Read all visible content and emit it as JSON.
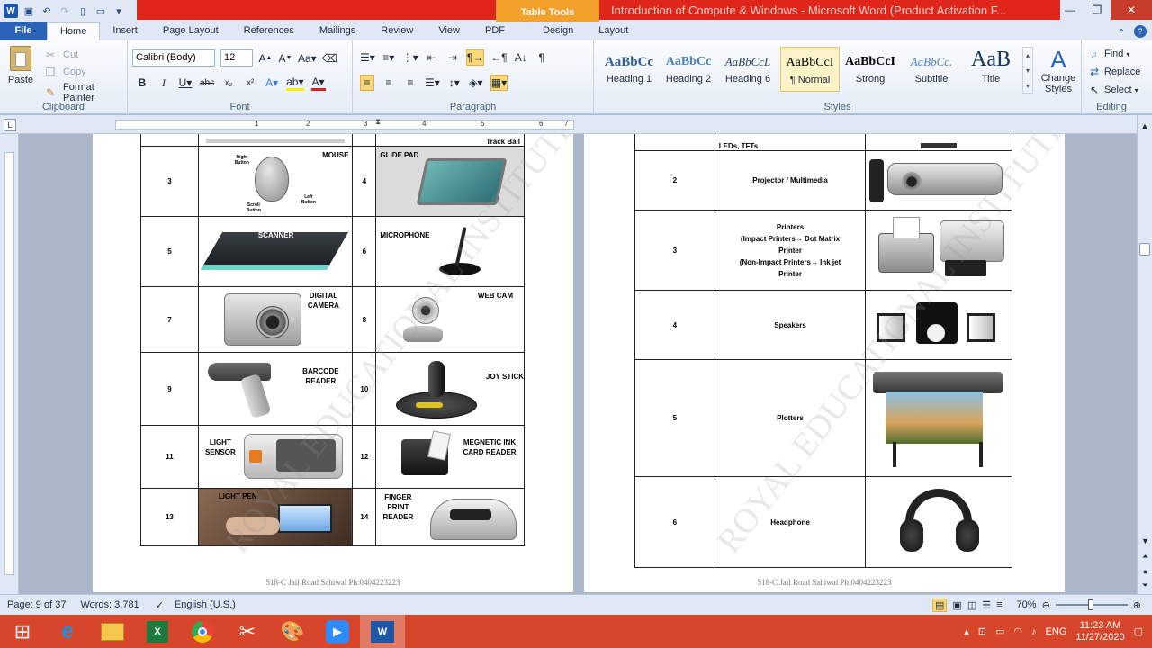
{
  "window": {
    "title": "Introduction of Compute & Windows - Microsoft Word (Product Activation F...",
    "contextual_tab": "Table Tools"
  },
  "tabs": [
    "File",
    "Home",
    "Insert",
    "Page Layout",
    "References",
    "Mailings",
    "Review",
    "View",
    "PDF",
    "Design",
    "Layout"
  ],
  "ribbon": {
    "clipboard": {
      "paste": "Paste",
      "cut": "Cut",
      "copy": "Copy",
      "format_painter": "Format Painter",
      "label": "Clipboard"
    },
    "font": {
      "name": "Calibri (Body)",
      "size": "12",
      "label": "Font"
    },
    "paragraph": {
      "label": "Paragraph"
    },
    "styles": {
      "items": [
        {
          "preview": "AaBbCc",
          "name": "Heading 1"
        },
        {
          "preview": "AaBbCc",
          "name": "Heading 2"
        },
        {
          "preview": "AaBbCcL",
          "name": "Heading 6"
        },
        {
          "preview": "AaBbCcI",
          "name": "¶ Normal"
        },
        {
          "preview": "AaBbCcI",
          "name": "Strong"
        },
        {
          "preview": "AaBbCc.",
          "name": "Subtitle"
        },
        {
          "preview": "AaB",
          "name": "Title"
        }
      ],
      "change_styles": "Change Styles",
      "label": "Styles"
    },
    "editing": {
      "find": "Find",
      "replace": "Replace",
      "select": "Select",
      "label": "Editing"
    }
  },
  "ruler_numbers": [
    "1",
    "2",
    "3",
    "4",
    "5",
    "6",
    "7"
  ],
  "page1": {
    "top_partial_label": "Track Ball",
    "rows": [
      {
        "n1": "3",
        "l1": "MOUSE",
        "n2": "4",
        "l2": "GLIDE PAD"
      },
      {
        "n1": "5",
        "l1": "SCANNER",
        "n2": "6",
        "l2": "MICROPHONE"
      },
      {
        "n1": "7",
        "l1": "DIGITAL CAMERA",
        "n2": "8",
        "l2": "WEB CAM"
      },
      {
        "n1": "9",
        "l1": "BARCODE READER",
        "n2": "10",
        "l2": "JOY STICK"
      },
      {
        "n1": "11",
        "l1": "LIGHT SENSOR",
        "n2": "12",
        "l2": "MEGNETIC INK CARD READER"
      },
      {
        "n1": "13",
        "l1": "LIGHT PEN",
        "n2": "14",
        "l2": "FINGER PRINT READER"
      }
    ],
    "mouse_parts": {
      "right": "Right Button",
      "left": "Left Button",
      "scroll": "Scroll Button"
    },
    "footer": "518-C Jail Road Sahiwal Ph:0404223223"
  },
  "page2": {
    "top_partial_label": "LEDs, TFTs",
    "rows": [
      {
        "n": "2",
        "label": "Projector / Multimedia"
      },
      {
        "n": "3",
        "label": "Printers (Impact Printers→ Dot Matrix Printer (Non-Impact Printers→ Ink jet Printer"
      },
      {
        "n": "4",
        "label": "Speakers"
      },
      {
        "n": "5",
        "label": "Plotters"
      },
      {
        "n": "6",
        "label": "Headphone"
      }
    ],
    "printer_lines": [
      "Printers",
      "(Impact Printers→ Dot Matrix",
      "Printer",
      "(Non-Impact Printers→ Ink jet",
      "Printer"
    ],
    "footer": "518-C Jail Road Sahiwal Ph:0404223223"
  },
  "watermark": "ROYAL EDUCATIONAL INSTITUTE",
  "status": {
    "page": "Page: 9 of 37",
    "words": "Words: 3,781",
    "language": "English (U.S.)",
    "zoom": "70%"
  },
  "tray": {
    "lang": "ENG",
    "time": "11:23 AM",
    "date": "11/27/2020"
  },
  "colors": {
    "title_red": "#e0251b",
    "table_tools": "#f3a12b",
    "taskbar": "#d7462a",
    "file_tab": "#2a63b8"
  }
}
